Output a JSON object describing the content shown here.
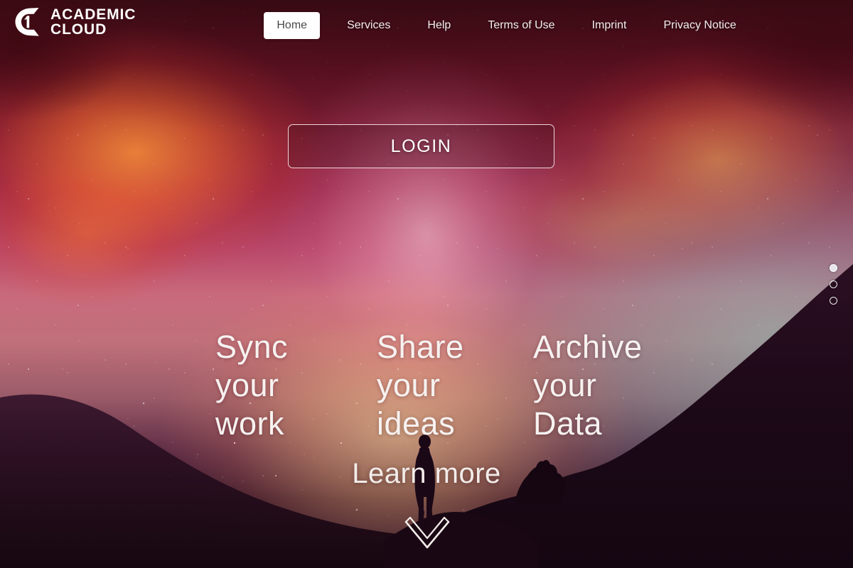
{
  "brand": {
    "logo_icon": "academic-cloud-c-logo",
    "line1": "ACADEMIC",
    "line2": "CLOUD"
  },
  "nav": {
    "items": [
      {
        "label": "Home",
        "active": true
      },
      {
        "label": "Services",
        "active": false
      },
      {
        "label": "Help",
        "active": false
      },
      {
        "label": "Terms of Use",
        "active": false
      },
      {
        "label": "Imprint",
        "active": false
      },
      {
        "label": "Privacy Notice",
        "active": false
      }
    ]
  },
  "hero": {
    "login_label": "LOGIN",
    "columns": [
      {
        "text": "Sync\nyour\nwork"
      },
      {
        "text": "Share\nyour\nideas"
      },
      {
        "text": "Archive\nyour\nData"
      }
    ],
    "learn_more_label": "Learn more",
    "scroll_icon": "chevron-down-icon"
  },
  "slider": {
    "dots": [
      {
        "index": 1,
        "active": true
      },
      {
        "index": 2,
        "active": false
      },
      {
        "index": 3,
        "active": false
      }
    ]
  },
  "colors": {
    "nav_active_bg": "#ffffff",
    "nav_active_text": "#4a4a4a",
    "nav_text": "#f4eef0",
    "hero_text": "#f6f2f0",
    "login_border": "#ffeef0",
    "nebula_orange": "#ff8c3c",
    "nebula_magenta": "#b9486a",
    "nebula_teal": "#78c8be",
    "landscape_silhouette": "#1a0a18"
  }
}
